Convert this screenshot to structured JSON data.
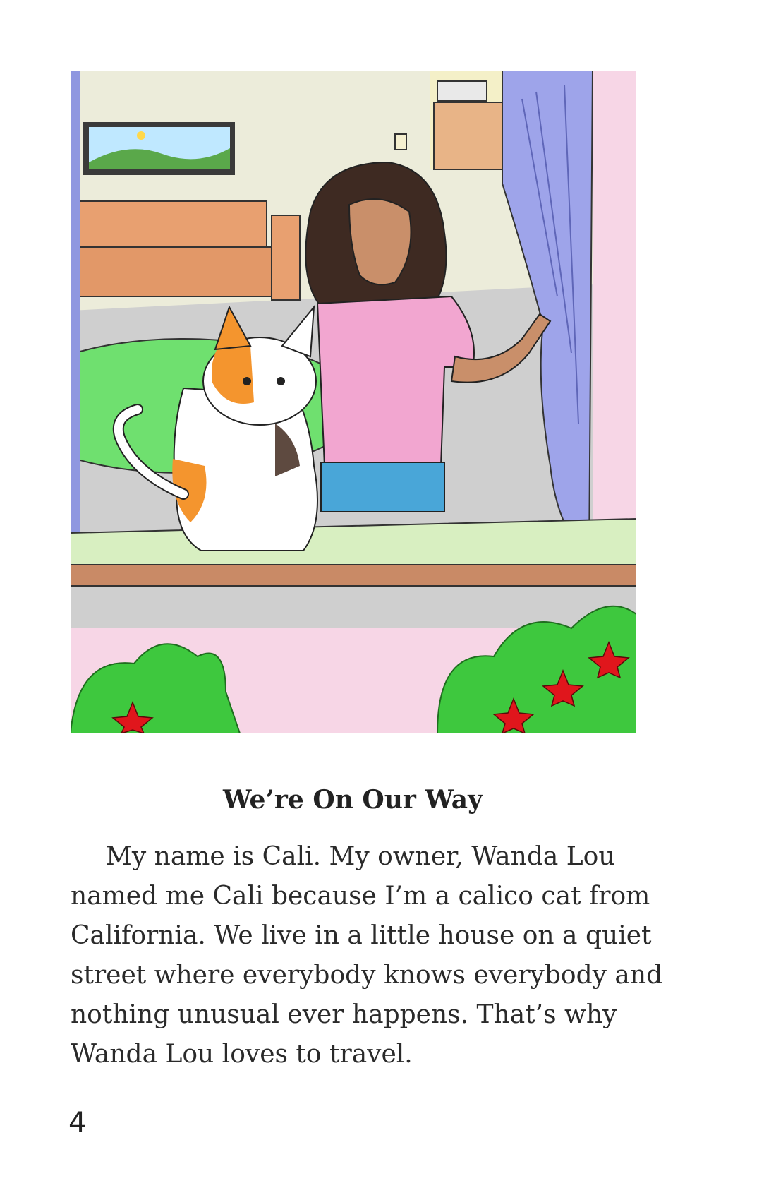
{
  "page": {
    "illustration": {
      "icon": "illustration-girl-and-calico-cat-at-window",
      "colors": {
        "wall": "#ececda",
        "floor": "#cfcfcf",
        "sofa": "#e8a070",
        "curtain": "#9ea4ea",
        "table": "#6fe06f",
        "shirt": "#f2a6d0",
        "jeans": "#49a6d8",
        "hair": "#3e2a22",
        "sill": "#c98a66",
        "windowsill_surface": "#d8efc1",
        "outer_wall": "#f7d6e6",
        "bush": "#3ec83e",
        "flower": "#e0161c"
      }
    },
    "title": "We’re On Our Way",
    "story_lines": [
      "My name is Cali. My owner, Wanda Lou",
      "named me Cali because I’m a calico cat from",
      "California. We live in a little house on a quiet",
      "street where everybody knows everybody and",
      "nothing unusual ever happens. That’s why",
      "Wanda Lou loves to travel."
    ],
    "page_number": "4"
  }
}
